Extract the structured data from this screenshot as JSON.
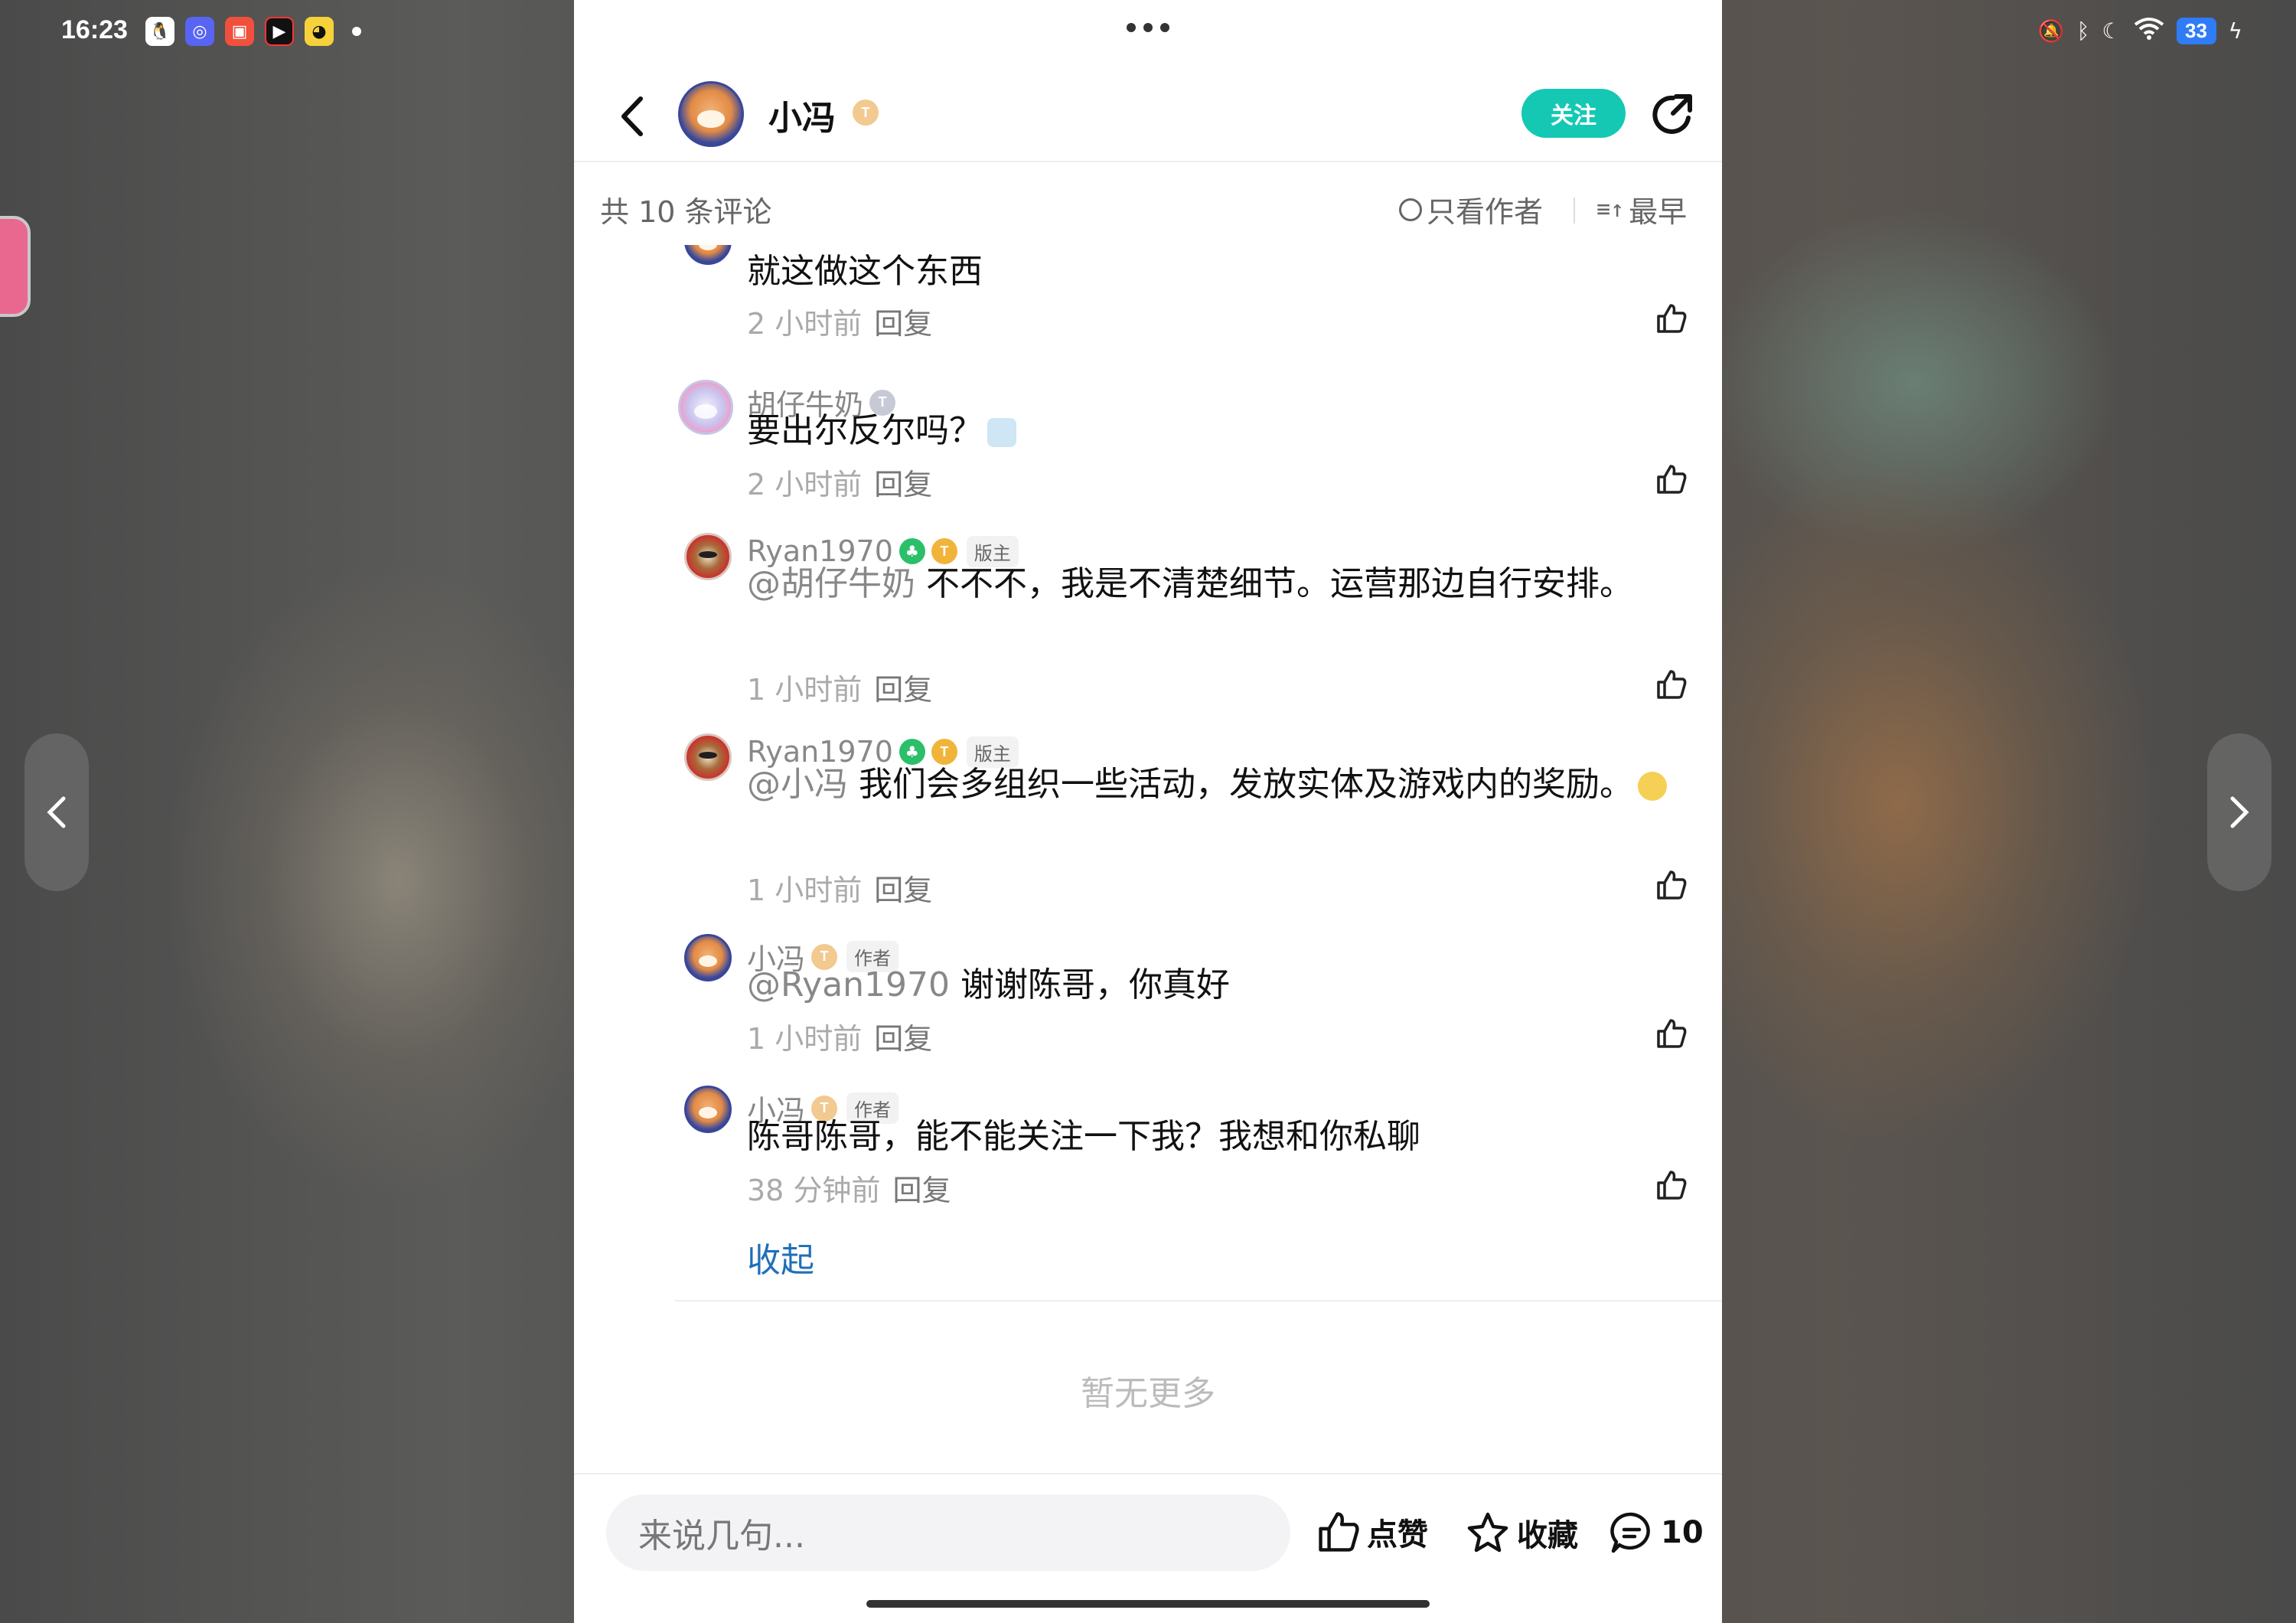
{
  "status_bar": {
    "time": "16:23",
    "apps": [
      "qq-icon",
      "discord-icon",
      "app-red-icon",
      "app-black-icon",
      "app-yellow-icon"
    ],
    "battery": "33"
  },
  "header": {
    "name": "小冯",
    "badge": "T",
    "follow_label": "关注"
  },
  "filter": {
    "count_label": "共 10 条评论",
    "author_only_label": "只看作者",
    "sort_label": "最早"
  },
  "replies": [
    {
      "text": "就这做这个东西",
      "time": "2 小时前",
      "reply_label": "回复"
    },
    {
      "user": "胡仔牛奶",
      "badge": "T",
      "text": "要出尔反尔吗？",
      "time": "2 小时前",
      "reply_label": "回复"
    },
    {
      "user": "Ryan1970",
      "badge": "T",
      "tag": "版主",
      "mention": "@胡仔牛奶",
      "text": " 不不不，我是不清楚细节。运营那边自行安排。",
      "time": "1 小时前",
      "reply_label": "回复"
    },
    {
      "user": "Ryan1970",
      "badge": "T",
      "tag": "版主",
      "mention": "@小冯",
      "text": " 我们会多组织一些活动，发放实体及游戏内的奖励。",
      "time": "1 小时前",
      "reply_label": "回复"
    },
    {
      "user": "小冯",
      "badge": "T",
      "tag": "作者",
      "mention": "@Ryan1970",
      "text": " 谢谢陈哥，你真好",
      "time": "1 小时前",
      "reply_label": "回复"
    },
    {
      "user": "小冯",
      "badge": "T",
      "tag": "作者",
      "text": "陈哥陈哥，能不能关注一下我？我想和你私聊",
      "time": "38 分钟前",
      "reply_label": "回复"
    }
  ],
  "collapse_label": "收起",
  "no_more_label": "暂无更多",
  "bottom": {
    "input_placeholder": "来说几句...",
    "like_label": "点赞",
    "fav_label": "收藏",
    "comment_count": "10"
  },
  "colors": {
    "accent": "#14c8b4",
    "link": "#1f6fb8",
    "moderator": "#2bbf6a"
  }
}
